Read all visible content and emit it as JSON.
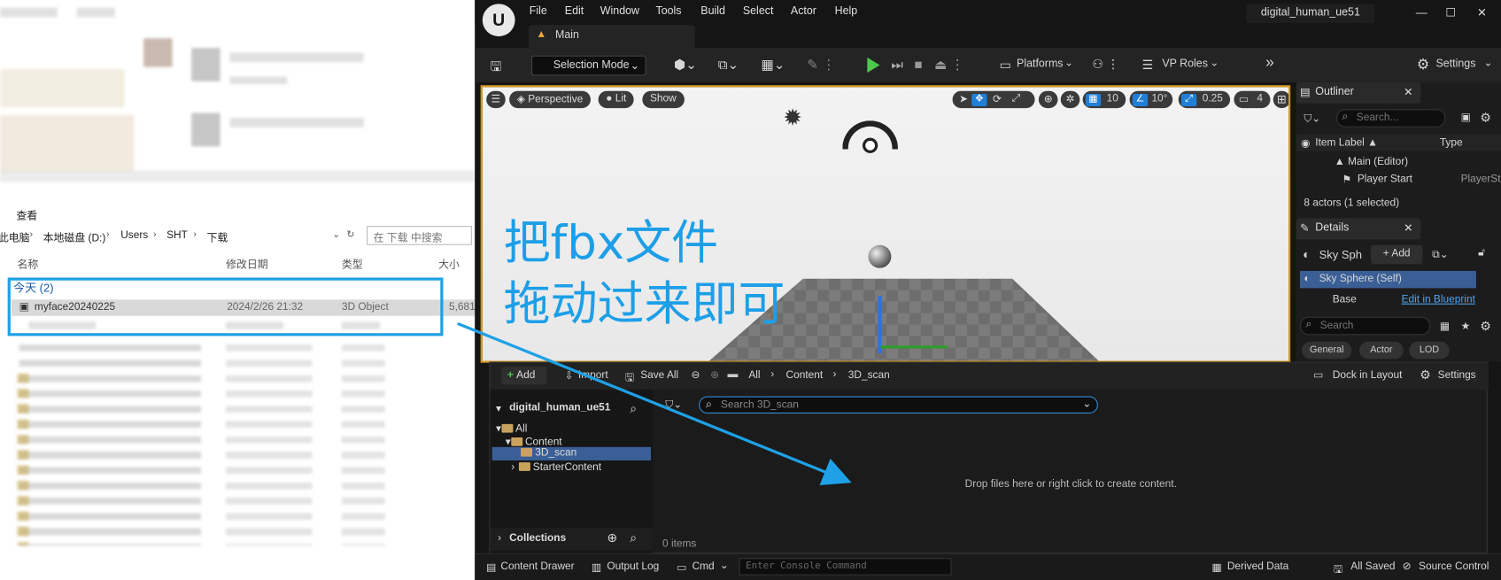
{
  "explorer": {
    "menu_view": "查看",
    "breadcrumb": [
      "此电脑",
      "本地磁盘 (D:)",
      "Users",
      "SHT",
      "下载"
    ],
    "search_placeholder": "在 下载 中搜索",
    "columns": [
      "名称",
      "修改日期",
      "类型",
      "大小"
    ],
    "group_label": "今天 (2)",
    "selected_file": {
      "name": "myface20240225",
      "date": "2024/2/26 21:32",
      "type": "3D Object",
      "size": "5,681"
    }
  },
  "annotation_text": [
    "把fbx文件",
    "拖动过来即可"
  ],
  "ue": {
    "menu": [
      "File",
      "Edit",
      "Window",
      "Tools",
      "Build",
      "Select",
      "Actor",
      "Help"
    ],
    "project_name": "digital_human_ue51",
    "main_tab": "Main",
    "toolbar": {
      "selection_mode": "Selection Mode",
      "platforms": "Platforms",
      "vp_roles": "VP Roles",
      "settings": "Settings"
    },
    "viewport": {
      "perspective": "Perspective",
      "lit": "Lit",
      "show": "Show",
      "grid": "10",
      "angle": "10°",
      "scale": "0.25",
      "camera_speed": "4"
    },
    "outliner": {
      "title": "Outliner",
      "search_placeholder": "Search...",
      "col_label": "Item Label ▲",
      "col_type": "Type",
      "rows": [
        {
          "label": "Main (Editor)",
          "type": ""
        },
        {
          "label": "Player Start",
          "type": "PlayerSta"
        }
      ],
      "status": "8 actors (1 selected)"
    },
    "details": {
      "title": "Details",
      "actor": "Sky Sph",
      "add": "+ Add",
      "self_row": "Sky Sphere (Self)",
      "base": "Base",
      "edit_bp": "Edit in Blueprint",
      "search_placeholder": "Search",
      "filters": [
        "General",
        "Actor",
        "LOD"
      ]
    },
    "content_browser": {
      "add": "Add",
      "import": "Import",
      "save_all": "Save All",
      "path": [
        "All",
        "Content",
        "3D_scan"
      ],
      "dock": "Dock in Layout",
      "settings": "Settings",
      "project": "digital_human_ue51",
      "tree": [
        "All",
        "Content",
        "3D_scan",
        "StarterContent"
      ],
      "search_placeholder": "Search 3D_scan",
      "drop_hint": "Drop files here or right click to create content.",
      "collections": "Collections",
      "item_count": "0 items"
    },
    "statusbar": {
      "content_drawer": "Content Drawer",
      "output_log": "Output Log",
      "cmd": "Cmd",
      "console_placeholder": "Enter Console Command",
      "derived_data": "Derived Data",
      "all_saved": "All Saved",
      "source_control": "Source Control"
    }
  },
  "colors": {
    "annotation": "#1d9fe8",
    "selection_outline": "#d79a1e",
    "ue_bg": "#151515",
    "play_green": "#4cc84c"
  }
}
